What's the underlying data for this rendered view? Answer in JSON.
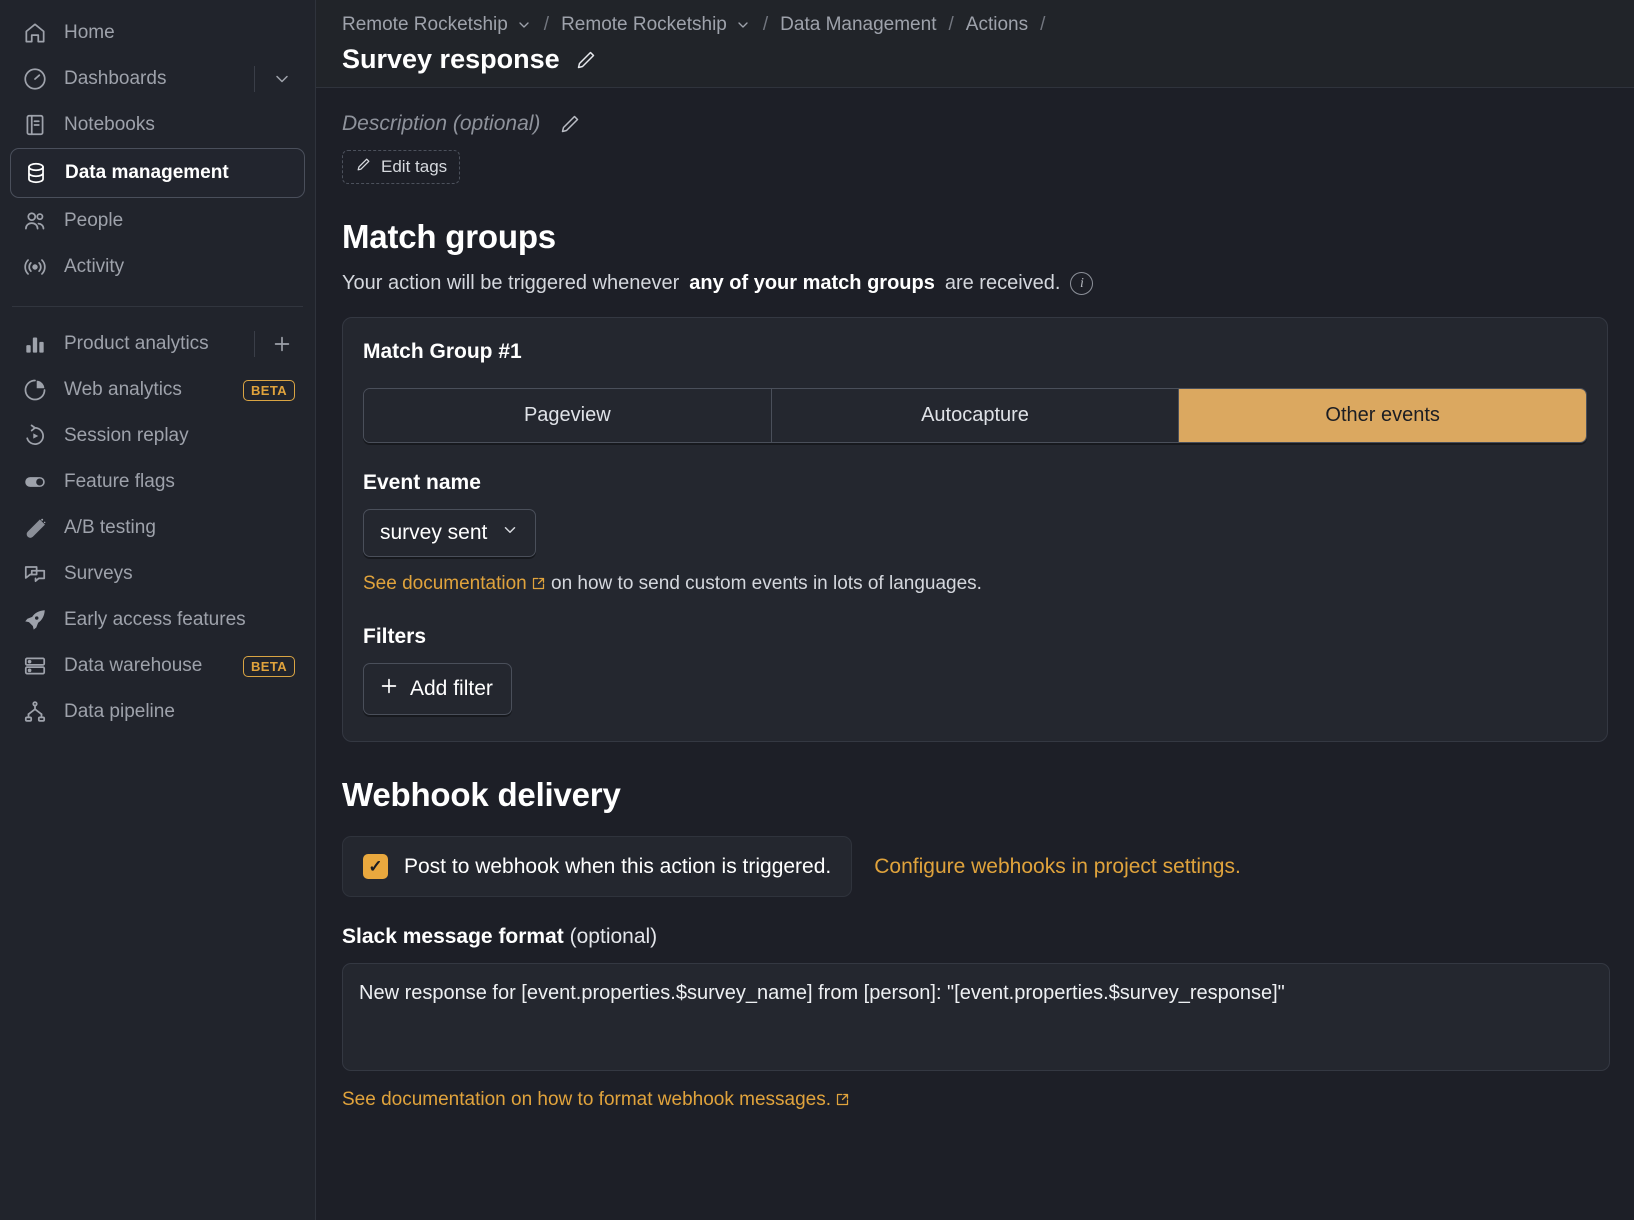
{
  "sidebar": {
    "primary": [
      {
        "label": "Home",
        "icon": "home-icon",
        "active": false
      },
      {
        "label": "Dashboards",
        "icon": "gauge-icon",
        "active": false,
        "caret": true
      },
      {
        "label": "Notebooks",
        "icon": "notebook-icon",
        "active": false
      },
      {
        "label": "Data management",
        "icon": "database-icon",
        "active": true
      },
      {
        "label": "People",
        "icon": "people-icon",
        "active": false
      },
      {
        "label": "Activity",
        "icon": "activity-icon",
        "active": false
      }
    ],
    "secondary": [
      {
        "label": "Product analytics",
        "icon": "bar-chart-icon",
        "plus": true
      },
      {
        "label": "Web analytics",
        "icon": "pie-chart-icon",
        "badge": "BETA"
      },
      {
        "label": "Session replay",
        "icon": "replay-icon"
      },
      {
        "label": "Feature flags",
        "icon": "toggle-icon"
      },
      {
        "label": "A/B testing",
        "icon": "flask-icon"
      },
      {
        "label": "Surveys",
        "icon": "chat-icon"
      },
      {
        "label": "Early access features",
        "icon": "rocket-icon"
      },
      {
        "label": "Data warehouse",
        "icon": "server-icon",
        "badge": "BETA"
      },
      {
        "label": "Data pipeline",
        "icon": "pipeline-icon"
      }
    ]
  },
  "header": {
    "breadcrumbs": [
      {
        "label": "Remote Rocketship",
        "caret": true
      },
      {
        "label": "Remote Rocketship",
        "caret": true
      },
      {
        "label": "Data Management",
        "caret": false
      },
      {
        "label": "Actions",
        "caret": false
      }
    ],
    "title": "Survey response",
    "edit_title_icon": "pencil-icon"
  },
  "description": {
    "placeholder": "Description (optional)",
    "edit_icon": "pencil-icon",
    "edit_tags_label": "Edit tags"
  },
  "match_groups": {
    "heading": "Match groups",
    "subtitle_prefix": "Your action will be triggered whenever ",
    "subtitle_bold": "any of your match groups",
    "subtitle_suffix": " are received.",
    "info_icon": "info-icon",
    "group_title": "Match Group #1",
    "tabs": [
      {
        "label": "Pageview",
        "active": false
      },
      {
        "label": "Autocapture",
        "active": false
      },
      {
        "label": "Other events",
        "active": true
      }
    ],
    "event_name_label": "Event name",
    "event_name_value": "survey sent",
    "doc_link_text": "See documentation",
    "doc_tail_text": " on how to send custom events in lots of languages.",
    "filters_label": "Filters",
    "add_filter_label": "Add filter"
  },
  "webhook": {
    "heading": "Webhook delivery",
    "checkbox_label": "Post to webhook when this action is triggered.",
    "checkbox_checked": true,
    "configure_link": "Configure webhooks in project settings.",
    "slack_label_bold": "Slack message format",
    "slack_label_optional": " (optional)",
    "message_value": "New response for [event.properties.$survey_name] from [person]: \"[event.properties.$survey_response]\"",
    "bottom_link": "See documentation on how to format webhook messages."
  },
  "colors": {
    "accent": "#e0a33c",
    "tab_active": "#dba860",
    "sidebar_bg": "#21242c",
    "content_bg": "#1d1f27",
    "card_bg": "#24272f"
  }
}
